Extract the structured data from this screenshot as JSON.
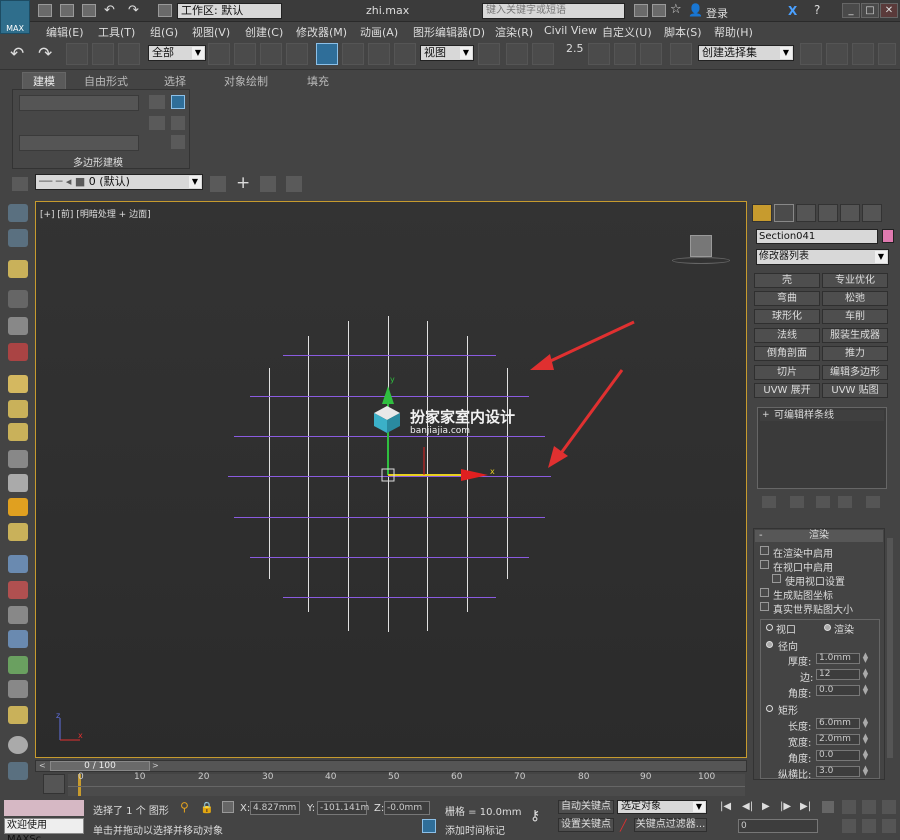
{
  "app": {
    "logo_text": "MAX",
    "workspace": "工作区: 默认",
    "doc_title": "zhi.max",
    "search_placeholder": "键入关键字或短语",
    "login": "登录"
  },
  "menu": [
    "编辑(E)",
    "工具(T)",
    "组(G)",
    "视图(V)",
    "创建(C)",
    "修改器(M)",
    "动画(A)",
    "图形编辑器(D)",
    "渲染(R)",
    "Civil View",
    "自定义(U)",
    "脚本(S)",
    "帮助(H)"
  ],
  "toolbar": {
    "filter": "全部",
    "refcoord": "视图",
    "snap_angle": "2.5",
    "selset": "创建选择集"
  },
  "ribbon": {
    "tabs": [
      "建模",
      "自由形式",
      "选择",
      "对象绘制",
      "填充"
    ],
    "panel_label": "多边形建模"
  },
  "layer": {
    "current": "0 (默认)"
  },
  "viewport": {
    "label": "[+] [前] [明暗处理 + 边面]",
    "watermark_title": "扮家家室内设计",
    "watermark_url": "banjiajia.com"
  },
  "command_panel": {
    "object_name": "Section041",
    "modifier_list": "修改器列表",
    "modifiers": [
      "壳",
      "专业优化",
      "弯曲",
      "松弛",
      "球形化",
      "车削",
      "法线",
      "服装生成器",
      "倒角剖面",
      "推力",
      "切片",
      "编辑多边形",
      "UVW 展开",
      "UVW 贴图"
    ],
    "stack_item": "可编辑样条线",
    "rollout": {
      "title": "渲染",
      "enable_render": "在渲染中启用",
      "enable_viewport": "在视口中启用",
      "use_viewport_settings": "使用视口设置",
      "gen_mapping": "生成贴图坐标",
      "real_world": "真实世界贴图大小",
      "viewport_radio": "视口",
      "render_radio": "渲染",
      "radial": "径向",
      "thickness_label": "厚度:",
      "thickness": "1.0mm",
      "sides_label": "边:",
      "sides": "12",
      "angle_label": "角度:",
      "angle": "0.0",
      "rect": "矩形",
      "length_label": "长度:",
      "length": "6.0mm",
      "width_label": "宽度:",
      "width": "2.0mm",
      "angle2_label": "角度:",
      "angle2": "0.0",
      "aspect_label": "纵横比:",
      "aspect": "3.0"
    }
  },
  "timeline": {
    "frame": "0 / 100",
    "ticks": [
      "0",
      "10",
      "20",
      "30",
      "40",
      "50",
      "60",
      "70",
      "80",
      "90",
      "100"
    ]
  },
  "status": {
    "welcome": "欢迎使用 MAXSc",
    "selected": "选择了 1 个 图形",
    "prompt": "单击并拖动以选择并移动对象",
    "x_label": "X:",
    "x": "4.827mm",
    "y_label": "Y:",
    "y": "-101.141m",
    "z_label": "Z:",
    "z": "-0.0mm",
    "grid": "栅格 = 10.0mm",
    "add_time_tag": "添加时间标记",
    "auto_key": "自动关键点",
    "set_key": "设置关键点",
    "selected_obj": "选定对象",
    "key_filters": "关键点过滤器...",
    "frame_field": "0"
  }
}
